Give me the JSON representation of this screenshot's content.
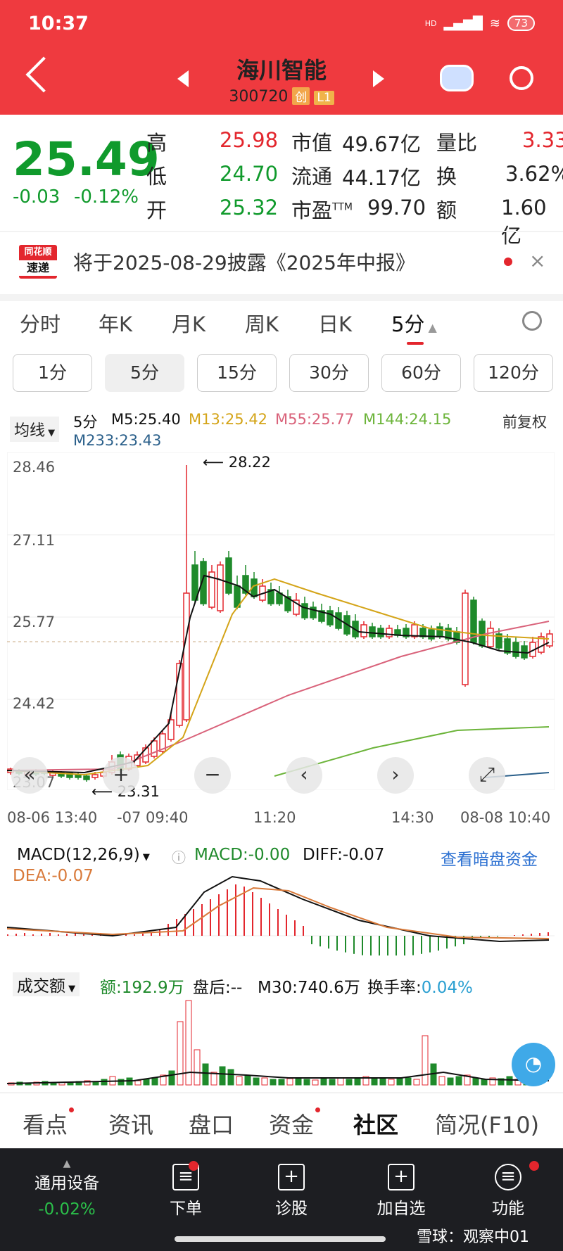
{
  "status": {
    "time": "10:37",
    "hd": "HD",
    "battery": "73"
  },
  "header": {
    "name": "海川智能",
    "code": "300720",
    "tag1": "创",
    "tag2": "L1"
  },
  "quote": {
    "price": "25.49",
    "change": "-0.03",
    "change_pct": "-0.12%",
    "high_label": "高",
    "high": "25.98",
    "low_label": "低",
    "low": "24.70",
    "open_label": "开",
    "open": "25.32",
    "mcap_label": "市值",
    "mcap": "49.67亿",
    "float_label": "流通",
    "float": "44.17亿",
    "pe_label": "市盈",
    "pe_sup": "TTM",
    "pe": "99.70",
    "vr_label": "量比",
    "vr": "3.33",
    "turn_label": "换",
    "turn": "3.62%",
    "amt_label": "额",
    "amt": "1.60亿"
  },
  "notice": {
    "logo_top": "同花顺",
    "logo_bottom": "速递",
    "text": "将于2025-08-29披露《2025年中报》",
    "close": "×"
  },
  "ktabs": [
    "分时",
    "年K",
    "月K",
    "周K",
    "日K",
    "5分"
  ],
  "periods": [
    "1分",
    "5分",
    "15分",
    "30分",
    "60分",
    "120分"
  ],
  "ma": {
    "selector": "均线",
    "period": "5分",
    "m5": "M5:25.40",
    "m13": "M13:25.42",
    "m55": "M55:25.77",
    "m144": "M144:24.15",
    "m233": "M233:23.43",
    "adjust": "前复权"
  },
  "chart": {
    "y_labels": [
      "28.46",
      "27.11",
      "25.77",
      "24.42",
      "23.07"
    ],
    "x_labels": [
      "08-06 13:40",
      "-07 09:40",
      "11:20",
      "14:30",
      "08-08 10:40"
    ],
    "high_marker": "28.22",
    "low_marker": "23.31",
    "colors": {
      "up": "#e3262d",
      "down": "#1f8a2b",
      "m5": "#111111",
      "m13": "#d4a418",
      "m55": "#d9627a",
      "m144": "#6cb43a",
      "m233": "#2a5f8a"
    }
  },
  "macd": {
    "label": "MACD(12,26,9)",
    "macd": "MACD:-0.00",
    "diff": "DIFF:-0.07",
    "dea": "DEA:-0.07",
    "link": "查看暗盘资金"
  },
  "vol": {
    "label": "成交额",
    "amt": "额:192.9万",
    "after": "盘后:--",
    "m30": "M30:740.6万",
    "turn_label": "换手率:",
    "turn": "0.04%"
  },
  "bottom_tabs": [
    "看点",
    "资讯",
    "盘口",
    "资金",
    "社区",
    "简况(F10)"
  ],
  "footer": {
    "sector": "通用设备",
    "sector_change": "-0.02%",
    "items": [
      "下单",
      "诊股",
      "加自选",
      "功能"
    ],
    "watermark": "雪球：观察中01"
  },
  "chart_data": {
    "type": "candlestick",
    "x": [
      "08-06 13:40",
      "-07 09:40",
      "11:20",
      "14:30",
      "08-08 10:40"
    ],
    "ylim": [
      23.07,
      28.46
    ],
    "annotations": {
      "max": 28.22,
      "min": 23.31
    },
    "ma_lines": {
      "M5": 25.4,
      "M13": 25.42,
      "M55": 25.77,
      "M144": 24.15,
      "M233": 23.43
    }
  }
}
